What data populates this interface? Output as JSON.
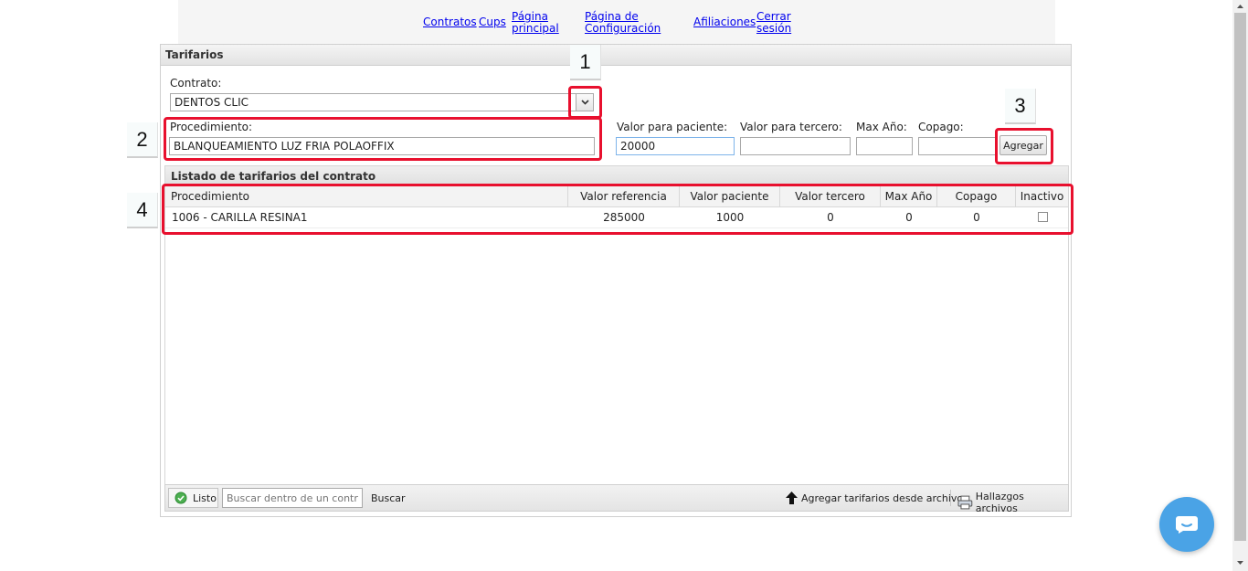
{
  "nav": {
    "contratos": "Contratos",
    "cups": "Cups",
    "pagina_principal": [
      "Página",
      "principal"
    ],
    "pagina_configuracion": [
      "Página de",
      "Configuración"
    ],
    "afiliaciones": "Afiliaciones",
    "cerrar_sesion": [
      "Cerrar",
      "sesión"
    ]
  },
  "panel": {
    "title": "Tarifarios"
  },
  "form": {
    "contrato_label": "Contrato:",
    "contrato_value": "DENTOS CLIC",
    "procedimiento_label": "Procedimiento:",
    "procedimiento_value": "BLANQUEAMIENTO LUZ FRIA POLAOFFIX",
    "valor_paciente_label": "Valor para paciente:",
    "valor_paciente_value": "20000",
    "valor_tercero_label": "Valor para tercero:",
    "valor_tercero_value": "",
    "max_anio_label": "Max Año:",
    "max_anio_value": "",
    "copago_label": "Copago:",
    "copago_value": "",
    "agregar_button": "Agregar"
  },
  "grid": {
    "caption": "Listado de tarifarios del contrato",
    "columns": [
      "Procedimiento",
      "Valor referencia",
      "Valor paciente",
      "Valor tercero",
      "Max Año",
      "Copago",
      "Inactivo"
    ],
    "rows": [
      {
        "procedimiento": "1006 - CARILLA RESINA1",
        "valor_referencia": "285000",
        "valor_paciente": "1000",
        "valor_tercero": "0",
        "max_anio": "0",
        "copago": "0",
        "inactivo": false
      }
    ]
  },
  "footer": {
    "status": "Listo",
    "search_placeholder": "Buscar dentro de un contrato",
    "buscar": "Buscar",
    "agregar_desde_archivo": "Agregar tarifarios desde archivo",
    "hallazgos": "Hallazgos archivos"
  },
  "callouts": [
    "1",
    "2",
    "3",
    "4"
  ],
  "colors": {
    "annotation_red": "#e8102e",
    "link_blue": "#0000ee",
    "chat_blue": "#4aa3e6",
    "status_green": "#4caf50"
  }
}
